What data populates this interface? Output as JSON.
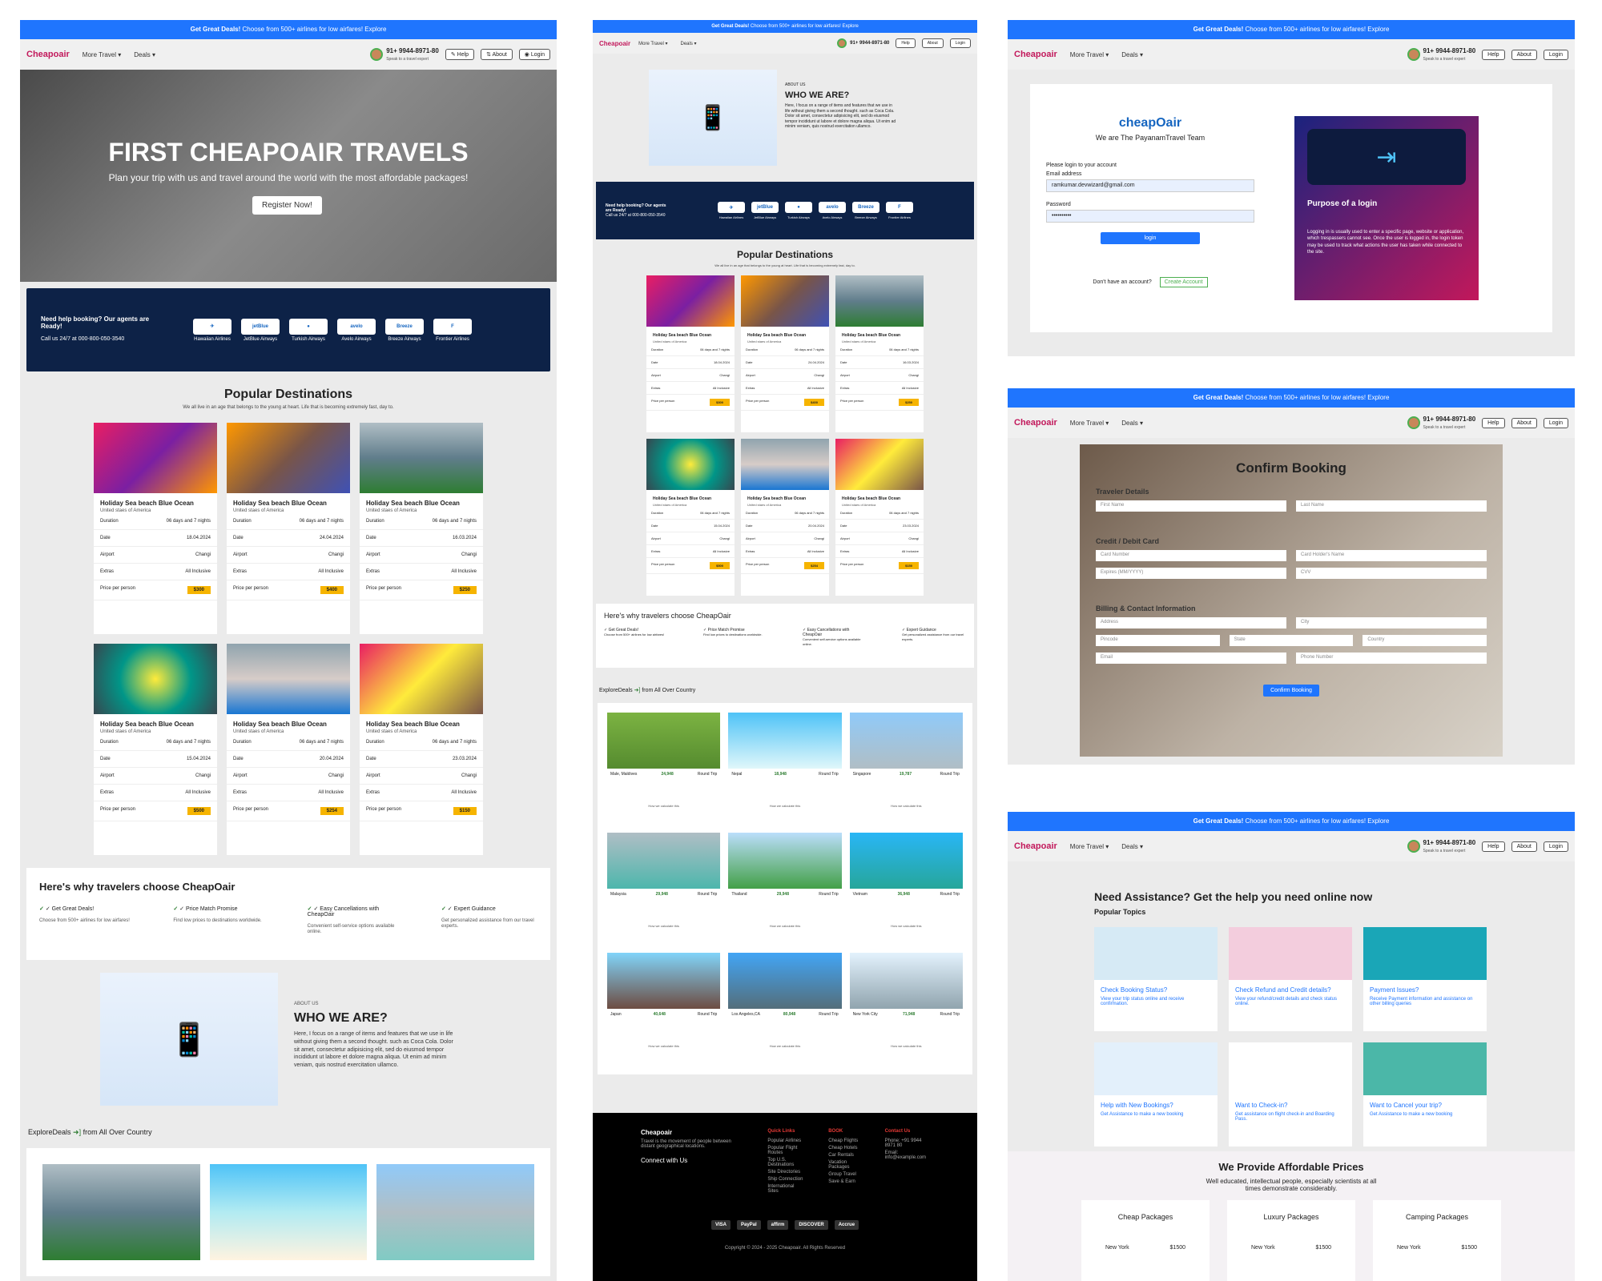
{
  "deal_bar": {
    "strong": "Get Great Deals!",
    "rest": "Choose from 500+ airlines for low airfares! Explore"
  },
  "nav": {
    "logo": "Cheapoair",
    "more_travel": "More Travel ▾",
    "deals": "Deals ▾",
    "phone": "91+ 9944-8971-80",
    "phone_sub": "Speak to a travel expert",
    "help": "Help",
    "about": "About",
    "login": "Login"
  },
  "hero": {
    "title": "FIRST CHEAPOAIR TRAVELS",
    "subtitle": "Plan your trip with us and travel around the world with the most affordable packages!",
    "cta": "Register Now!"
  },
  "agents": {
    "title": "Need help booking? Our agents are Ready!",
    "call": "Call us 24/7 at 000-800-050-3540",
    "airlines": [
      {
        "name": "Hawaiian Airlines",
        "mark": "✈"
      },
      {
        "name": "JetBlue Airways",
        "mark": "jetBlue"
      },
      {
        "name": "Turkish Airways",
        "mark": "●"
      },
      {
        "name": "Avelo Airways",
        "mark": "avelo"
      },
      {
        "name": "Breeze Airways",
        "mark": "Breeze"
      },
      {
        "name": "Frontier Airlines",
        "mark": "F"
      }
    ]
  },
  "popular": {
    "title": "Popular Destinations",
    "subtitle": "We all live in an age that belongs to the young at heart. Life that is becoming extremely fast, day to.",
    "labels": {
      "duration": "Duration",
      "date": "Date",
      "airport": "Airport",
      "extras": "Extras",
      "price": "Price per person"
    },
    "cards": [
      {
        "name": "Holiday Sea beach Blue Ocean",
        "loc": "United staes of America",
        "duration": "06 days and 7 nights",
        "date": "18.04.2024",
        "airport": "Changi",
        "extras": "All Inclusive",
        "price": "$300"
      },
      {
        "name": "Holiday Sea beach Blue Ocean",
        "loc": "United staes of America",
        "duration": "06 days and 7 nights",
        "date": "24.04.2024",
        "airport": "Changi",
        "extras": "All Inclusive",
        "price": "$400"
      },
      {
        "name": "Holiday Sea beach Blue Ocean",
        "loc": "United staes of America",
        "duration": "06 days and 7 nights",
        "date": "16.03.2024",
        "airport": "Changi",
        "extras": "All Inclusive",
        "price": "$250"
      },
      {
        "name": "Holiday Sea beach Blue Ocean",
        "loc": "United staes of America",
        "duration": "06 days and 7 nights",
        "date": "15.04.2024",
        "airport": "Changi",
        "extras": "All Inclusive",
        "price": "$500"
      },
      {
        "name": "Holiday Sea beach Blue Ocean",
        "loc": "United staes of America",
        "duration": "06 days and 7 nights",
        "date": "20.04.2024",
        "airport": "Changi",
        "extras": "All Inclusive",
        "price": "$254"
      },
      {
        "name": "Holiday Sea beach Blue Ocean",
        "loc": "United staes of America",
        "duration": "06 days and 7 nights",
        "date": "23.03.2024",
        "airport": "Changi",
        "extras": "All Inclusive",
        "price": "$150"
      }
    ]
  },
  "why": {
    "title": "Here's why travelers choose CheapOair",
    "items": [
      {
        "h": "Get Great Deals!",
        "d": "Choose from 500+ airlines for low airfares!"
      },
      {
        "h": "Price Match Promise",
        "d": "Find low prices to destinations worldwide."
      },
      {
        "h": "Easy Cancellations with CheapOair",
        "d": "Convenient self-service options available online."
      },
      {
        "h": "Expert Guidance",
        "d": "Get personalized assistance from our travel experts."
      }
    ]
  },
  "about": {
    "kicker": "ABOUT US",
    "title": "WHO WE ARE?",
    "text": "Here, I focus on a range of items and features that we use in life without giving them a second thought. such as Coca Cola. Dolor sit amet, consectetur adipisicing elit, sed do eiusmod tempor incididunt ut labore et dolore magna aliqua. Ut enim ad minim veniam, quis nostrud exercitation ullamco."
  },
  "explore": {
    "pre": "ExploreDeals",
    "post": "from All Over Country",
    "deals": [
      {
        "city": "Male, Maldives",
        "price": "24,948",
        "trip": "Round Trip"
      },
      {
        "city": "Nepal",
        "price": "18,948",
        "trip": "Round Trip"
      },
      {
        "city": "Singapore",
        "price": "19,787",
        "trip": "Round Trip"
      },
      {
        "city": "Malaysia",
        "price": "29,948",
        "trip": "Round Trip"
      },
      {
        "city": "Thailand",
        "price": "29,948",
        "trip": "Round Trip"
      },
      {
        "city": "Vietnam",
        "price": "36,948",
        "trip": "Round Trip"
      },
      {
        "city": "Japan",
        "price": "40,648",
        "trip": "Round Trip"
      },
      {
        "city": "Los Angeles,CA",
        "price": "80,948",
        "trip": "Round Trip"
      },
      {
        "city": "New York City",
        "price": "71,948",
        "trip": "Round Trip"
      }
    ],
    "calc": "How we calculate this"
  },
  "footer": {
    "brand": "Cheapoair",
    "connect": "Connect with Us",
    "cols": [
      {
        "h": "Quick Links",
        "items": [
          "Popular Airlines",
          "Popular Flight Routes",
          "Top U.S. Destinations",
          "Site Directories",
          "Ship Connection",
          "International Sites"
        ]
      },
      {
        "h": "BOOK",
        "items": [
          "Cheap Flights",
          "Cheap Hotels",
          "Car Rentals",
          "Vacation Packages",
          "Group Travel",
          "Save & Earn"
        ]
      },
      {
        "h": "Contact Us",
        "items": [
          "Phone: +91 9944 8971 80",
          "Email: info@example.com"
        ]
      }
    ],
    "pay": [
      "VISA",
      "PayPal",
      "affirm",
      "DISCOVER",
      "Accrue"
    ],
    "copy": "Copyright © 2024 - 2025 Cheapoair. All Rights Reserved"
  },
  "login": {
    "brand": "cheapOair",
    "team": "We are The PayanamTravel Team",
    "prompt": "Please login to your account",
    "email_label": "Email address",
    "email_value": "ramkumar.devwizard@gmail.com",
    "password_label": "Password",
    "password_value": "••••••••••",
    "btn": "login",
    "no_account": "Don't have an account?",
    "create": "Create Account",
    "purpose_title": "Purpose of a login",
    "purpose_text": "Logging in is usually used to enter a specific page, website or application, which trespassers cannot see. Once the user is logged in, the login token may be used to track what actions the user has taken while connected to the site."
  },
  "confirm": {
    "title": "Confirm Booking",
    "traveler": "Traveler Details",
    "first": "First Name",
    "last": "Last Name",
    "card_sec": "Credit / Debit Card",
    "card_no": "Card Number",
    "holder": "Card Holder's Name",
    "expires": "Expires (MM/YYYY)",
    "cvv": "CVV",
    "billing": "Billing & Contact Information",
    "address": "Address",
    "city": "City",
    "pincode": "Pincode",
    "state": "State",
    "country": "Country",
    "email": "Email",
    "phone": "Phone Number",
    "btn": "Confirm Booking"
  },
  "help": {
    "title": "Need Assistance? Get the help you need online now",
    "sub": "Popular Topics",
    "topics": [
      {
        "h": "Check Booking Status?",
        "d": "View your trip status online and receive confirmation."
      },
      {
        "h": "Check Refund and Credit details?",
        "d": "View your refund/credit details and check status online."
      },
      {
        "h": "Payment Issues?",
        "d": "Receive Payment information and assistance on other billing queries"
      },
      {
        "h": "Help with New Bookings?",
        "d": "Get Assistance to make a new booking"
      },
      {
        "h": "Want to Check-in?",
        "d": "Get assistance on flight check-in and Boarding Pass."
      },
      {
        "h": "Want to Cancel your trip?",
        "d": "Get Assistance to make a new booking"
      }
    ],
    "afford_title": "We Provide Affordable Prices",
    "afford_text": "Well educated, intellectual people, especially scientists at all times demonstrate considerably.",
    "packs": [
      {
        "name": "Cheap Packages",
        "city": "New York",
        "price": "$1500"
      },
      {
        "name": "Luxury Packages",
        "city": "New York",
        "price": "$1500"
      },
      {
        "name": "Camping Packages",
        "city": "New York",
        "price": "$1500"
      }
    ]
  }
}
